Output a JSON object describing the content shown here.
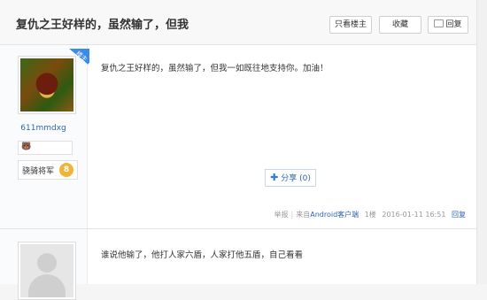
{
  "header": {
    "title": "复仇之王好样的，虽然输了，但我",
    "btn_author": "只看楼主",
    "btn_fav": "收藏",
    "btn_reply": "回复"
  },
  "post1": {
    "badge": "楼主",
    "username": "611mmdxg",
    "emoji": "🐻",
    "rank_label": "骁骑将军",
    "rank_level": "8",
    "content": "复仇之王好样的，虽然输了，但我一如既往地支持你。加油！",
    "share": "分享",
    "share_count": "(0)",
    "footer": {
      "report": "举报",
      "source_prefix": "来自",
      "source_link": "Android客户端",
      "floor": "1楼",
      "time": "2016-01-11 16:51",
      "reply": "回复"
    }
  },
  "post2": {
    "content": "谁说他输了，他打人家六盾，人家打他五盾，自己看看"
  },
  "colors": {
    "link": "#2d64b3",
    "badge": "#3b8be8",
    "rank": "#f0b43a"
  }
}
